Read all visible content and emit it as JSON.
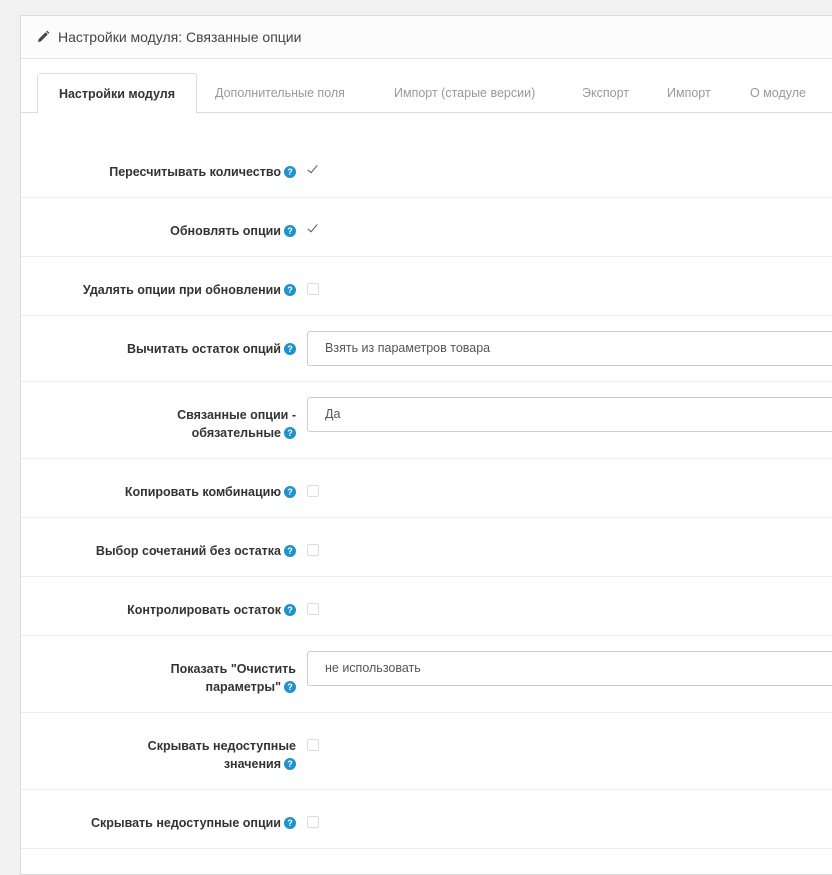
{
  "header": {
    "title": "Настройки модуля: Связанные опции",
    "icon": "pencil-icon"
  },
  "tabs": [
    {
      "label": "Настройки модуля",
      "active": true
    },
    {
      "label": "Дополнительные поля",
      "active": false
    },
    {
      "label": "Импорт (старые версии)",
      "active": false
    },
    {
      "label": "Экспорт",
      "active": false
    },
    {
      "label": "Импорт",
      "active": false
    },
    {
      "label": "О модуле",
      "active": false
    }
  ],
  "help_glyph": "?",
  "colors": {
    "help_icon": "#1e91cf",
    "border": "#dddddd"
  },
  "fields": [
    {
      "label": "Пересчитывать количество",
      "type": "checkbox",
      "checked": true
    },
    {
      "label": "Обновлять опции",
      "type": "checkbox",
      "checked": true
    },
    {
      "label": "Удалять опции при обновлении",
      "type": "checkbox",
      "checked": false
    },
    {
      "label": "Вычитать остаток опций",
      "type": "select",
      "value": "Взять из параметров товара"
    },
    {
      "label_line1": "Связанные опции -",
      "label_line2": "обязательные",
      "type": "select",
      "value": "Да"
    },
    {
      "label": "Копировать комбинацию",
      "type": "checkbox",
      "checked": false
    },
    {
      "label": "Выбор сочетаний без остатка",
      "type": "checkbox",
      "checked": false
    },
    {
      "label": "Контролировать остаток",
      "type": "checkbox",
      "checked": false
    },
    {
      "label_line1": "Показать \"Очистить",
      "label_line2": "параметры\"",
      "type": "select",
      "value": "не использовать"
    },
    {
      "label_line1": "Скрывать недоступные",
      "label_line2": "значения",
      "type": "checkbox",
      "checked": false
    },
    {
      "label": "Скрывать недоступные опции",
      "type": "checkbox",
      "checked": false
    }
  ]
}
